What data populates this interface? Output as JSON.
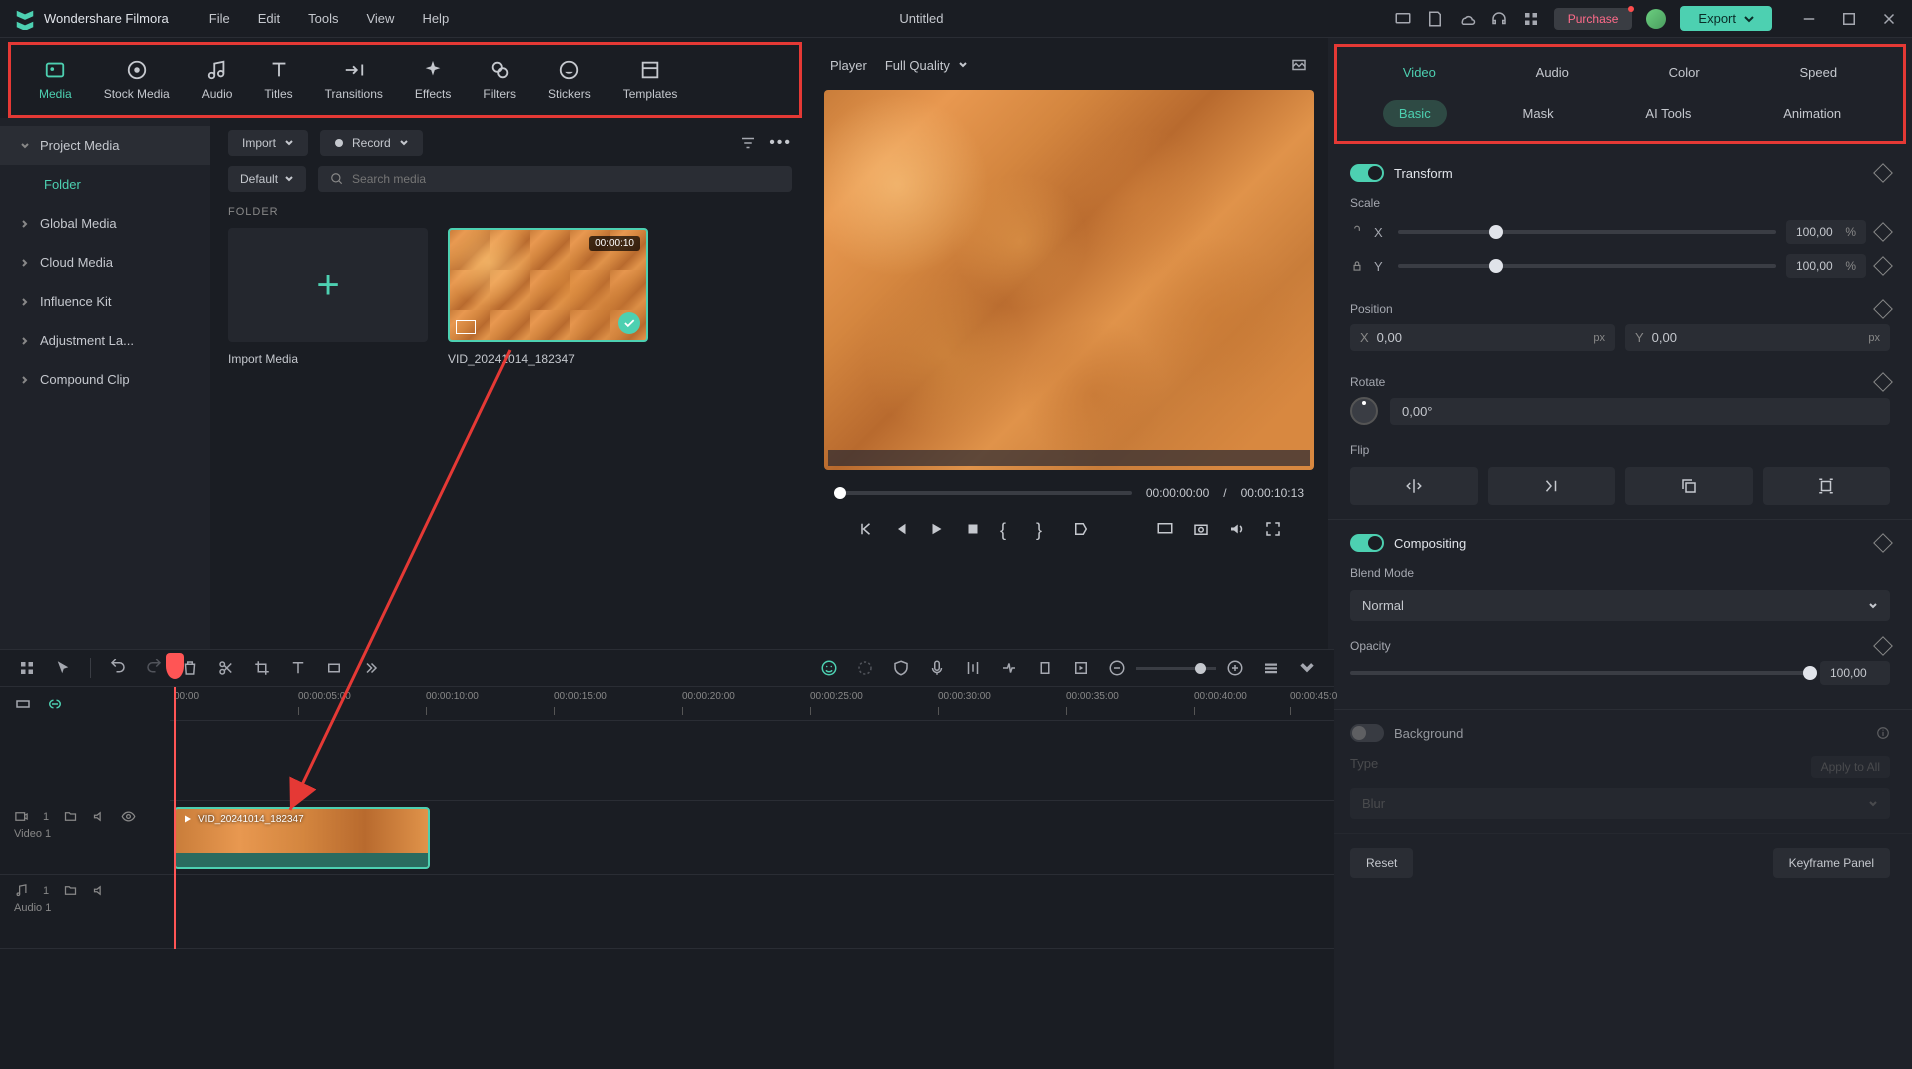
{
  "app": {
    "name": "Wondershare Filmora",
    "document_title": "Untitled"
  },
  "menubar": [
    "File",
    "Edit",
    "Tools",
    "View",
    "Help"
  ],
  "title_buttons": {
    "purchase": "Purchase",
    "export": "Export"
  },
  "media_tabs": [
    "Media",
    "Stock Media",
    "Audio",
    "Titles",
    "Transitions",
    "Effects",
    "Filters",
    "Stickers",
    "Templates"
  ],
  "media_sidebar": {
    "project_media": "Project Media",
    "folder": "Folder",
    "items": [
      "Global Media",
      "Cloud Media",
      "Influence Kit",
      "Adjustment La...",
      "Compound Clip"
    ]
  },
  "media_toolbar": {
    "import": "Import",
    "record": "Record",
    "sort": "Default",
    "search_placeholder": "Search media"
  },
  "media_content": {
    "folder_label": "FOLDER",
    "import_label": "Import Media",
    "clip": {
      "name": "VID_20241014_182347",
      "duration": "00:00:10"
    }
  },
  "player": {
    "label": "Player",
    "quality": "Full Quality",
    "current_time": "00:00:00:00",
    "total_time": "00:00:10:13"
  },
  "inspector": {
    "tabs": [
      "Video",
      "Audio",
      "Color",
      "Speed"
    ],
    "subtabs": [
      "Basic",
      "Mask",
      "AI Tools",
      "Animation"
    ],
    "transform": {
      "title": "Transform",
      "scale_label": "Scale",
      "scale_x": "100,00",
      "scale_y": "100,00",
      "pct": "%",
      "position_label": "Position",
      "pos_x": "0,00",
      "pos_y": "0,00",
      "px": "px",
      "rotate_label": "Rotate",
      "rotate_val": "0,00°",
      "flip_label": "Flip"
    },
    "compositing": {
      "title": "Compositing",
      "blend_label": "Blend Mode",
      "blend_value": "Normal",
      "opacity_label": "Opacity",
      "opacity_value": "100,00"
    },
    "background": {
      "title": "Background",
      "type_label": "Type",
      "apply_all": "Apply to All",
      "blur": "Blur"
    },
    "footer": {
      "reset": "Reset",
      "keyframe": "Keyframe Panel"
    }
  },
  "timeline": {
    "ruler": [
      "00:00",
      "00:00:05:00",
      "00:00:10:00",
      "00:00:15:00",
      "00:00:20:00",
      "00:00:25:00",
      "00:00:30:00",
      "00:00:35:00",
      "00:00:40:00",
      "00:00:45:0"
    ],
    "video_track": "Video 1",
    "audio_track": "Audio 1",
    "clip_label": "VID_20241014_182347"
  }
}
